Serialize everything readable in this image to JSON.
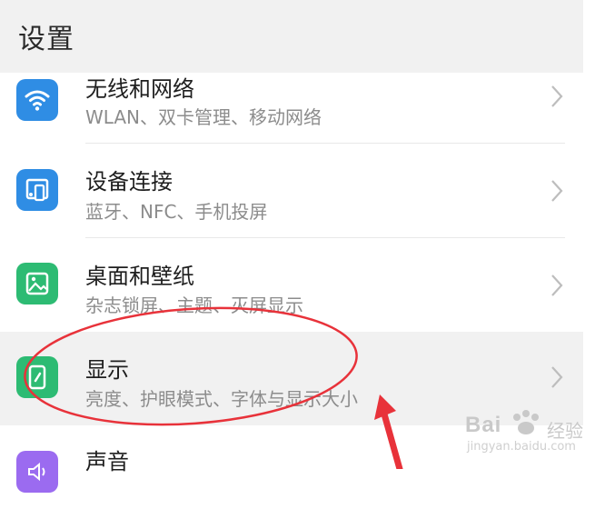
{
  "header": {
    "title": "设置"
  },
  "items": [
    {
      "title": "无线和网络",
      "subtitle": "WLAN、双卡管理、移动网络",
      "icon": "wifi-icon",
      "icon_color": "#2f8de4"
    },
    {
      "title": "设备连接",
      "subtitle": "蓝牙、NFC、手机投屏",
      "icon": "device-connect-icon",
      "icon_color": "#2f8de4"
    },
    {
      "title": "桌面和壁纸",
      "subtitle": "杂志锁屏、主题、灭屏显示",
      "icon": "wallpaper-icon",
      "icon_color": "#2dbb73"
    },
    {
      "title": "显示",
      "subtitle": "亮度、护眼模式、字体与显示大小",
      "icon": "display-icon",
      "icon_color": "#2dbb73"
    },
    {
      "title": "声音",
      "icon": "sound-icon",
      "icon_color": "#9b6bf0"
    }
  ],
  "annotation_color": "#e8323a",
  "watermark": {
    "brand": "Bai",
    "brand_suffix": "经验",
    "url": "jingyan.baidu.com"
  }
}
